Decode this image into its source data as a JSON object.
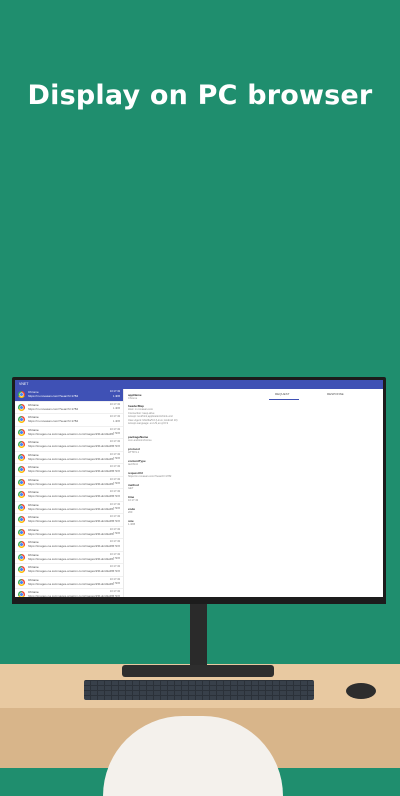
{
  "headline": "Display on PC browser",
  "app": {
    "title": "VNET"
  },
  "tabs": [
    "REQUEST",
    "RESPONSE"
  ],
  "requests": [
    {
      "app": "Chrome",
      "url": "https://m.novasan.com/?search=1782",
      "time": "10:17:43",
      "size": "1.4KB"
    },
    {
      "app": "Chrome",
      "url": "https://m.novasan.com/?search=1782",
      "time": "10:17:43",
      "size": "1.4KB"
    },
    {
      "app": "Chrome",
      "url": "https://m.novasan.com/?search=1782",
      "time": "10:17:43",
      "size": "1.4KB"
    },
    {
      "app": "Chrome",
      "url": "https://images-na.ssl-images-amazon.com/images/I/41ukm9vdfb",
      "time": "10:17:43",
      "size": "7.5KB"
    },
    {
      "app": "Chrome",
      "url": "https://images-na.ssl-images-amazon.com/images/I/41ukm9vdfb",
      "time": "10:17:43",
      "size": "7.5KB"
    },
    {
      "app": "Chrome",
      "url": "https://images-na.ssl-images-amazon.com/images/I/41ukm9vdfb",
      "time": "10:17:43",
      "size": "7.5KB"
    },
    {
      "app": "Chrome",
      "url": "https://images-na.ssl-images-amazon.com/images/I/41ukm9vdfb",
      "time": "10:17:43",
      "size": "7.5KB"
    },
    {
      "app": "Chrome",
      "url": "https://images-na.ssl-images-amazon.com/images/I/41ukm9vdfb",
      "time": "10:17:43",
      "size": "7.5KB"
    },
    {
      "app": "Chrome",
      "url": "https://images-na.ssl-images-amazon.com/images/I/41ukm9vdfb",
      "time": "10:17:43",
      "size": "7.5KB"
    },
    {
      "app": "Chrome",
      "url": "https://images-na.ssl-images-amazon.com/images/I/41ukm9vdfb",
      "time": "10:17:43",
      "size": "7.5KB"
    },
    {
      "app": "Chrome",
      "url": "https://images-na.ssl-images-amazon.com/images/I/41ukm9vdfb",
      "time": "10:17:43",
      "size": "7.5KB"
    },
    {
      "app": "Chrome",
      "url": "https://images-na.ssl-images-amazon.com/images/I/41ukm9vdfb",
      "time": "10:17:43",
      "size": "7.5KB"
    },
    {
      "app": "Chrome",
      "url": "https://images-na.ssl-images-amazon.com/images/I/41ukm9vdfb",
      "time": "10:17:43",
      "size": "7.5KB"
    },
    {
      "app": "Chrome",
      "url": "https://images-na.ssl-images-amazon.com/images/I/41ukm9vdfb",
      "time": "10:17:43",
      "size": "7.5KB"
    },
    {
      "app": "Chrome",
      "url": "https://images-na.ssl-images-amazon.com/images/I/41ukm9vdfb",
      "time": "10:17:43",
      "size": "7.5KB"
    },
    {
      "app": "Chrome",
      "url": "https://images-na.ssl-images-amazon.com/images/I/41ukm9vdfb",
      "time": "10:17:43",
      "size": "7.5KB"
    },
    {
      "app": "Chrome",
      "url": "https://images-na.ssl-images-amazon.com/images/I/41ukm9vdfb",
      "time": "10:17:43",
      "size": "7.5KB"
    }
  ],
  "detail": {
    "applabel": {
      "key": "appName",
      "value": "Chrome"
    },
    "headers": {
      "key": "headerMap",
      "lines": [
        "Host: m.novasan.com",
        "Connection: keep-alive",
        "Accept: text/html,application/xhtml+xml",
        "User-Agent: Mozilla/5.0 (Linux; Android 10)",
        "Accept-Language: en-US,en;q=0.9"
      ]
    },
    "package": {
      "key": "packageName",
      "value": "com.android.chrome"
    },
    "protocol": {
      "key": "protocol",
      "value": "HTTP/1.1"
    },
    "contentType": {
      "key": "contentType",
      "value": "text/html"
    },
    "requestUrl": {
      "key": "requestUrl",
      "value": "https://m.novasan.com/?search=1782"
    },
    "method": {
      "key": "method",
      "value": "GET"
    },
    "time": {
      "key": "time",
      "value": "10:17:43"
    },
    "code": {
      "key": "code",
      "value": "200"
    },
    "size": {
      "key": "size",
      "value": "1.4KB"
    }
  }
}
